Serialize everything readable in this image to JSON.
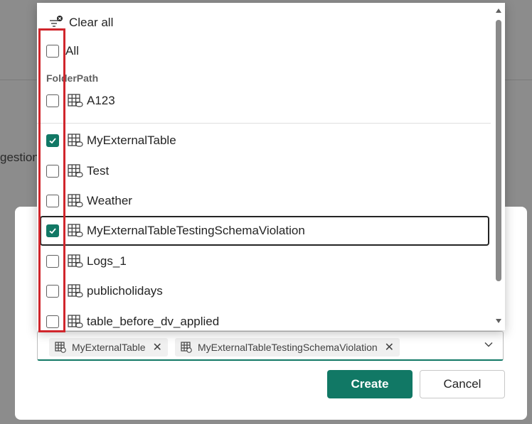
{
  "background": {
    "partial_text": "gestion,"
  },
  "dropdown": {
    "clear_all_label": "Clear all",
    "all_label": "All",
    "group_label": "FolderPath",
    "items": [
      {
        "label": "A123",
        "checked": false
      },
      {
        "label": "MyExternalTable",
        "checked": true
      },
      {
        "label": "Test",
        "checked": false
      },
      {
        "label": "Weather",
        "checked": false
      },
      {
        "label": "MyExternalTableTestingSchemaViolation",
        "checked": true
      },
      {
        "label": "Logs_1",
        "checked": false
      },
      {
        "label": "publicholidays",
        "checked": false
      },
      {
        "label": "table_before_dv_applied",
        "checked": false
      }
    ]
  },
  "selected_chips": [
    {
      "label": "MyExternalTable"
    },
    {
      "label": "MyExternalTableTestingSchemaViolation"
    }
  ],
  "buttons": {
    "create_label": "Create",
    "cancel_label": "Cancel"
  },
  "colors": {
    "accent": "#117865",
    "highlight": "#d0262c"
  }
}
